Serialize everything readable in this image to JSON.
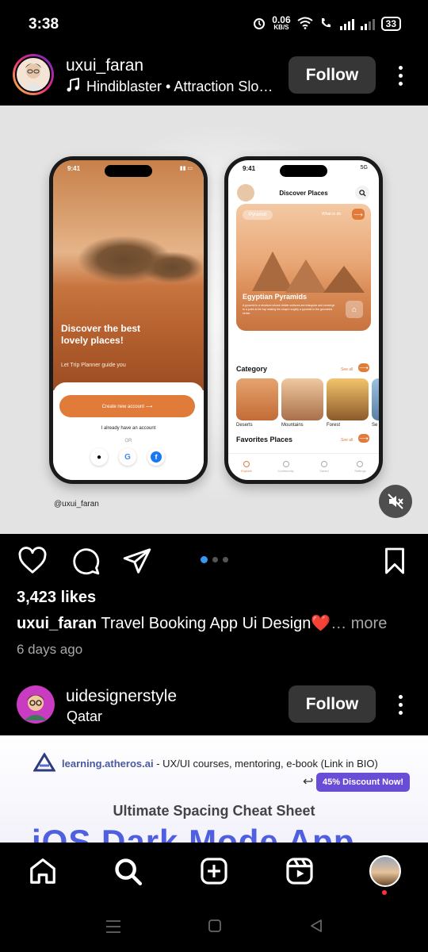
{
  "status_bar": {
    "time": "3:38",
    "speed_value": "0.06",
    "speed_unit": "KB/S",
    "battery": "33"
  },
  "post": {
    "username": "uxui_faran",
    "audio_line": "Hindiblaster • Attraction Slo…",
    "follow_label": "Follow",
    "image": {
      "phone1": {
        "time": "9:41",
        "title": "Discover the best lovely places!",
        "subtitle": "Let Trip Planner guide you",
        "cta": "Create new account ⟶",
        "link": "I already have an account",
        "or": "OR"
      },
      "phone2": {
        "time": "9:41",
        "network": "5G",
        "header": "Discover Places",
        "chip": "Pyramid",
        "what_to_do": "What to do",
        "card_title": "Egyptian Pyramids",
        "card_desc": "A pyramid is a structure whose visible surfaces are triangular and converge to a point at the top making the shape roughly a pyramid in the geometric sense.",
        "category_title": "Category",
        "see_all": "See all",
        "categories": [
          "Deserts",
          "Mountains",
          "Forest",
          "Se"
        ],
        "favorites_title": "Favorites Places",
        "tabs": [
          "Explore",
          "Community",
          "Saved",
          "Settings"
        ]
      },
      "handle": "@uxui_faran"
    },
    "likes": "3,423 likes",
    "caption_user": "uxui_faran",
    "caption_text": "Travel Booking App Ui Design❤️",
    "caption_more": "… more",
    "date": "6 days ago"
  },
  "second_post": {
    "username": "uidesignerstyle",
    "location": "Qatar",
    "follow_label": "Follow",
    "brand": "learning.atheros.ai",
    "ad_text": "- UX/UI courses, mentoring, e-book (Link in BIO)",
    "discount": "45% Discount Now!",
    "cheat_title": "Ultimate Spacing Cheat Sheet",
    "big_title": "iOS Dark Mode App"
  },
  "colors": {
    "accent_orange": "#e07b3a",
    "follow_bg": "#363636",
    "carousel_active": "#3897f0",
    "notification_dot": "#ff3040"
  }
}
